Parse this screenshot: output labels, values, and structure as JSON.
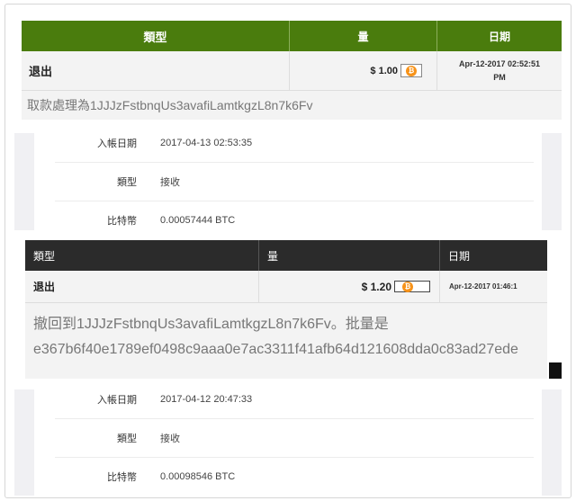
{
  "withdrawal_1": {
    "header": {
      "type": "類型",
      "amount": "量",
      "date": "日期"
    },
    "type": "退出",
    "amount": "$ 1.00",
    "coin_symbol": "₿",
    "date_line1": "Apr-12-2017 02:52:51",
    "date_line2": "PM",
    "message": "取款處理為1JJJzFstbnqUs3avafiLamtkgzL8n7k6Fv"
  },
  "receive_1": {
    "date_label": "入帳日期",
    "date_value": "2017-04-13 02:53:35",
    "type_label": "類型",
    "type_value": "接收",
    "btc_label": "比特幣",
    "btc_value": "0.00057444 BTC"
  },
  "withdrawal_2": {
    "header": {
      "type": "類型",
      "amount": "量",
      "date": "日期"
    },
    "type": "退出",
    "amount": "$ 1.20",
    "coin_symbol": "₿",
    "date": "Apr-12-2017 01:46:1",
    "message_line1": "撤回到1JJJzFstbnqUs3avafiLamtkgzL8n7k6Fv。批量是",
    "message_line2": "e367b6f40e1789ef0498c9aaa0e7ac3311f41afb64d121608dda0c83ad27ede"
  },
  "receive_2": {
    "date_label": "入帳日期",
    "date_value": "2017-04-12 20:47:33",
    "type_label": "類型",
    "type_value": "接收",
    "btc_label": "比特幣",
    "btc_value": "0.00098546 BTC"
  },
  "colors": {
    "green_header": "#4a7c0d",
    "dark_header": "#2b2b2b",
    "bitcoin_orange": "#f7931a"
  }
}
